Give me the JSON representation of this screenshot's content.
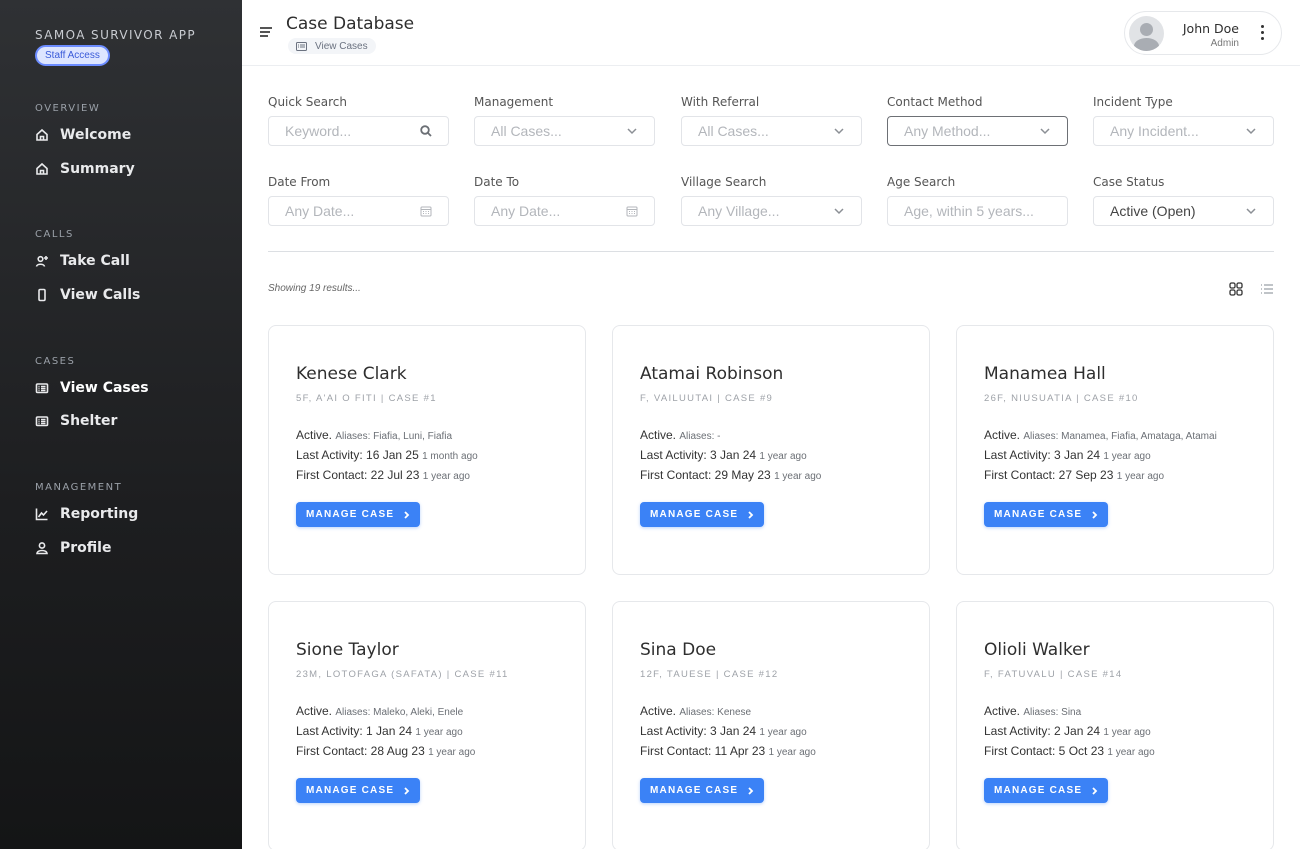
{
  "sidebar": {
    "app_title": "SAMOA SURVIVOR APP",
    "badge": "Staff Access",
    "sections": [
      {
        "label": "OVERVIEW",
        "items": [
          {
            "label": "Welcome",
            "icon": "home-icon"
          },
          {
            "label": "Summary",
            "icon": "home-icon"
          }
        ]
      },
      {
        "label": "CALLS",
        "items": [
          {
            "label": "Take Call",
            "icon": "user-plus-icon"
          },
          {
            "label": "View Calls",
            "icon": "phone-icon"
          }
        ]
      },
      {
        "label": "CASES",
        "items": [
          {
            "label": "View Cases",
            "icon": "list-icon",
            "active": true
          },
          {
            "label": "Shelter",
            "icon": "list-icon"
          }
        ]
      },
      {
        "label": "MANAGEMENT",
        "items": [
          {
            "label": "Reporting",
            "icon": "chart-icon"
          },
          {
            "label": "Profile",
            "icon": "user-icon"
          }
        ]
      }
    ]
  },
  "header": {
    "title": "Case Database",
    "breadcrumb": "View Cases",
    "user_name": "John Doe",
    "user_role": "Admin"
  },
  "filters": {
    "quick_search": {
      "label": "Quick Search",
      "placeholder": "Keyword..."
    },
    "management": {
      "label": "Management",
      "placeholder": "All Cases..."
    },
    "with_referral": {
      "label": "With Referral",
      "placeholder": "All Cases..."
    },
    "contact_method": {
      "label": "Contact Method",
      "placeholder": "Any Method..."
    },
    "incident_type": {
      "label": "Incident Type",
      "placeholder": "Any Incident..."
    },
    "date_from": {
      "label": "Date From",
      "placeholder": "Any Date..."
    },
    "date_to": {
      "label": "Date To",
      "placeholder": "Any Date..."
    },
    "village_search": {
      "label": "Village Search",
      "placeholder": "Any Village..."
    },
    "age_search": {
      "label": "Age Search",
      "placeholder": "Age, within 5 years..."
    },
    "case_status": {
      "label": "Case Status",
      "value": "Active (Open)"
    }
  },
  "results": {
    "showing": "Showing 19 results..."
  },
  "colors": {
    "accent": "#3b82f6",
    "sidebar_bg": "#1d1e20"
  },
  "button_label": "MANAGE CASE",
  "cards": [
    {
      "name": "Kenese Clark",
      "sub": "5F, A'AI O FITI | CASE #1",
      "status": "Active.",
      "aliases": "Aliases: Fiafia, Luni, Fiafia",
      "last_activity": "Last Activity: 16 Jan 25",
      "last_ago": "1 month ago",
      "first_contact": "First Contact: 22 Jul 23",
      "first_ago": "1 year ago"
    },
    {
      "name": "Atamai Robinson",
      "sub": "F, VAILUUTAI | CASE #9",
      "status": "Active.",
      "aliases": "Aliases: -",
      "last_activity": "Last Activity: 3 Jan 24",
      "last_ago": "1 year ago",
      "first_contact": "First Contact: 29 May 23",
      "first_ago": "1 year ago"
    },
    {
      "name": "Manamea Hall",
      "sub": "26F, NIUSUATIA | CASE #10",
      "status": "Active.",
      "aliases": "Aliases: Manamea, Fiafia, Amataga, Atamai",
      "last_activity": "Last Activity: 3 Jan 24",
      "last_ago": "1 year ago",
      "first_contact": "First Contact: 27 Sep 23",
      "first_ago": "1 year ago"
    },
    {
      "name": "Sione Taylor",
      "sub": "23M, LOTOFAGA (SAFATA) | CASE #11",
      "status": "Active.",
      "aliases": "Aliases: Maleko, Aleki, Enele",
      "last_activity": "Last Activity: 1 Jan 24",
      "last_ago": "1 year ago",
      "first_contact": "First Contact: 28 Aug 23",
      "first_ago": "1 year ago"
    },
    {
      "name": "Sina Doe",
      "sub": "12F, TAUESE | CASE #12",
      "status": "Active.",
      "aliases": "Aliases: Kenese",
      "last_activity": "Last Activity: 3 Jan 24",
      "last_ago": "1 year ago",
      "first_contact": "First Contact: 11 Apr 23",
      "first_ago": "1 year ago"
    },
    {
      "name": "Olioli Walker",
      "sub": "F, FATUVALU | CASE #14",
      "status": "Active.",
      "aliases": "Aliases: Sina",
      "last_activity": "Last Activity: 2 Jan 24",
      "last_ago": "1 year ago",
      "first_contact": "First Contact: 5 Oct 23",
      "first_ago": "1 year ago"
    }
  ]
}
